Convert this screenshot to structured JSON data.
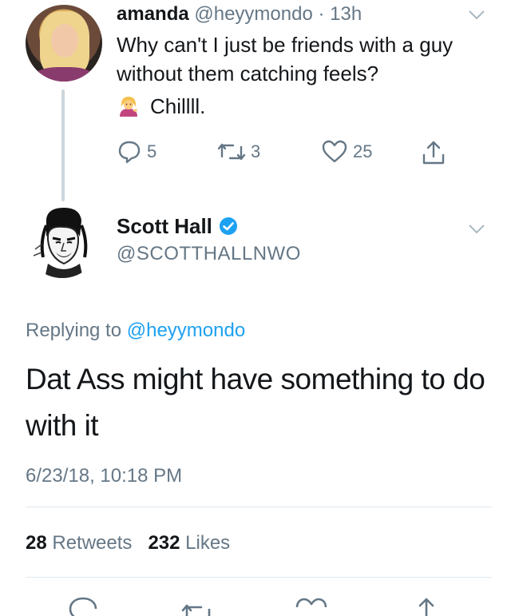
{
  "parent_tweet": {
    "name": "amanda",
    "handle": "@heyymondo",
    "separator": "·",
    "time": "13h",
    "text": "Why can't I just be friends with a guy without them catching feels?",
    "emoji_icon": "woman-tipping-hand-emoji",
    "emoji_text": "Chillll.",
    "reply_count": "5",
    "retweet_count": "3",
    "like_count": "25"
  },
  "main_tweet": {
    "name": "Scott Hall",
    "handle": "@SCOTTHALLNWO",
    "verified_color": "#1da1f2",
    "replying_prefix": "Replying to",
    "replying_to": "@heyymondo",
    "text": "Dat Ass might have something to do with it",
    "timestamp": "6/23/18, 10:18 PM",
    "retweets_count": "28",
    "retweets_label": "Retweets",
    "likes_count": "232",
    "likes_label": "Likes"
  },
  "colors": {
    "text": "#14171a",
    "secondary": "#657786",
    "link": "#1da1f2",
    "divider": "#e1e8ed"
  }
}
